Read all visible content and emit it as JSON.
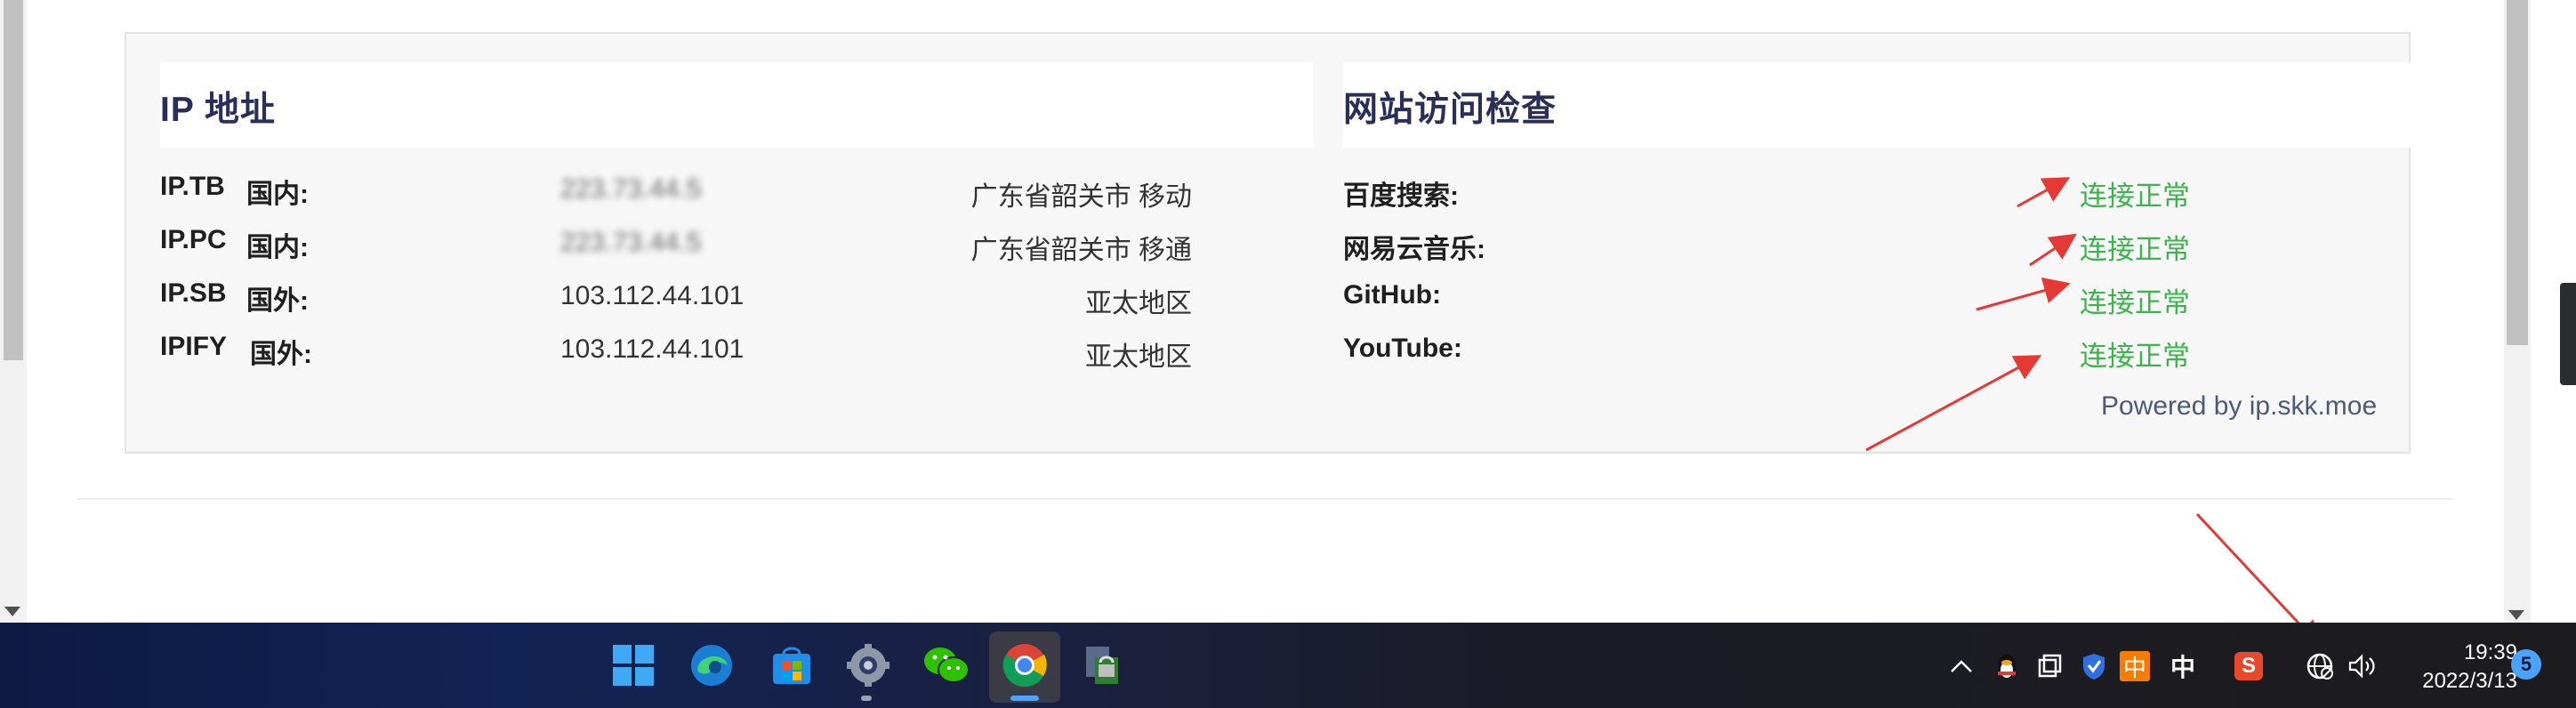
{
  "ip_section": {
    "title": "IP 地址",
    "rows": [
      {
        "source": "IP.TB",
        "region": "国内:",
        "ip": "223.73.44.5",
        "location": "广东省韶关市 移动"
      },
      {
        "source": "IP.PC",
        "region": "国内:",
        "ip": "223.73.44.5",
        "location": "广东省韶关市 移通"
      },
      {
        "source": "IP.SB",
        "region": "国外:",
        "ip": "103.112.44.101",
        "location": "亚太地区"
      },
      {
        "source": "IPIFY",
        "region": "国外:",
        "ip": "103.112.44.101",
        "location": "亚太地区"
      }
    ]
  },
  "access_section": {
    "title": "网站访问检查",
    "rows": [
      {
        "site": "百度搜索:",
        "status": "连接正常"
      },
      {
        "site": "网易云音乐:",
        "status": "连接正常"
      },
      {
        "site": "GitHub:",
        "status": "连接正常"
      },
      {
        "site": "YouTube:",
        "status": "连接正常"
      }
    ],
    "powered_by": "Powered by ip.skk.moe"
  },
  "colors": {
    "status_ok": "#3ab54a",
    "title": "#2a2f5a",
    "annotation_arrow": "#e53935"
  },
  "taskbar": {
    "apps": [
      "windows-start",
      "edge",
      "microsoft-store",
      "settings",
      "wechat",
      "chrome",
      "file-lock-tool"
    ],
    "active_app": "chrome",
    "tray": {
      "ime_primary": "中",
      "ime_secondary": "中",
      "sogou": "S"
    },
    "clock": {
      "time": "19:39",
      "date": "2022/3/13"
    },
    "notification_count": "5"
  }
}
